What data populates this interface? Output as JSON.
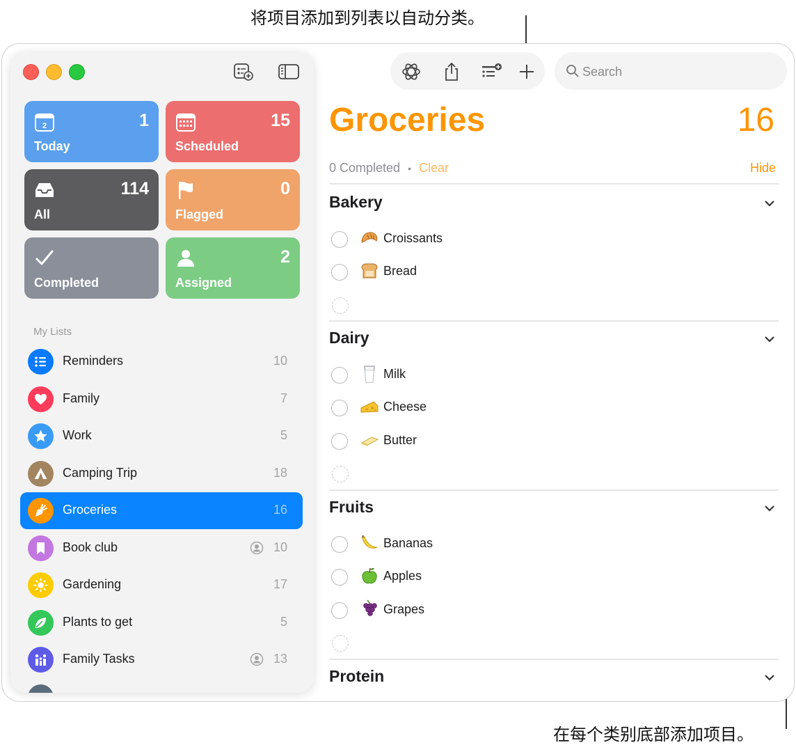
{
  "callouts": {
    "top": "将项目添加到列表以自动分类。",
    "bottom": "在每个类别底部添加项目。"
  },
  "sidebar": {
    "smart_lists": [
      {
        "label": "Today",
        "count": "1",
        "color": "#5aa0ee",
        "icon": "calendar-today-icon",
        "day": "2"
      },
      {
        "label": "Scheduled",
        "count": "15",
        "color": "#ec6e6e",
        "icon": "calendar-grid-icon"
      },
      {
        "label": "All",
        "count": "114",
        "color": "#5c5c5e",
        "icon": "tray-icon"
      },
      {
        "label": "Flagged",
        "count": "0",
        "color": "#f0a46a",
        "icon": "flag-icon"
      },
      {
        "label": "Completed",
        "count": "",
        "color": "#8a8f99",
        "icon": "checkmark-icon"
      },
      {
        "label": "Assigned",
        "count": "2",
        "color": "#7ccc84",
        "icon": "person-icon"
      }
    ],
    "section_title": "My Lists",
    "lists": [
      {
        "name": "Reminders",
        "count": "10",
        "color": "#0a7aff",
        "icon": "list-bullet-icon"
      },
      {
        "name": "Family",
        "count": "7",
        "color": "#ff3b5c",
        "icon": "heart-icon"
      },
      {
        "name": "Work",
        "count": "5",
        "color": "#3a9bf5",
        "icon": "star-icon"
      },
      {
        "name": "Camping Trip",
        "count": "18",
        "color": "#a2845e",
        "icon": "tent-icon"
      },
      {
        "name": "Groceries",
        "count": "16",
        "color": "#ff9500",
        "icon": "carrot-icon",
        "selected": true
      },
      {
        "name": "Book club",
        "count": "10",
        "color": "#c377e0",
        "icon": "bookmark-icon",
        "shared": true
      },
      {
        "name": "Gardening",
        "count": "17",
        "color": "#ffcc00",
        "icon": "sun-icon"
      },
      {
        "name": "Plants to get",
        "count": "5",
        "color": "#34c759",
        "icon": "leaf-icon"
      },
      {
        "name": "Family Tasks",
        "count": "13",
        "color": "#5e5ce6",
        "icon": "family-icon",
        "shared": true
      }
    ]
  },
  "toolbar": {
    "search_placeholder": "Search",
    "icons": [
      "apple-intelligence-icon",
      "share-icon",
      "add-section-icon",
      "plus-icon"
    ]
  },
  "main": {
    "title": "Groceries",
    "total": "16",
    "completed_text": "0 Completed",
    "separator": "•",
    "clear_label": "Clear",
    "hide_label": "Hide",
    "categories": [
      {
        "name": "Bakery",
        "items": [
          {
            "name": "Croissants",
            "emoji": "croissant-icon"
          },
          {
            "name": "Bread",
            "emoji": "bread-icon"
          }
        ]
      },
      {
        "name": "Dairy",
        "items": [
          {
            "name": "Milk",
            "emoji": "milk-glass-icon"
          },
          {
            "name": "Cheese",
            "emoji": "cheese-icon"
          },
          {
            "name": "Butter",
            "emoji": "butter-icon"
          }
        ]
      },
      {
        "name": "Fruits",
        "items": [
          {
            "name": "Bananas",
            "emoji": "banana-icon"
          },
          {
            "name": "Apples",
            "emoji": "green-apple-icon"
          },
          {
            "name": "Grapes",
            "emoji": "grapes-icon"
          }
        ]
      },
      {
        "name": "Protein",
        "items": []
      }
    ]
  }
}
